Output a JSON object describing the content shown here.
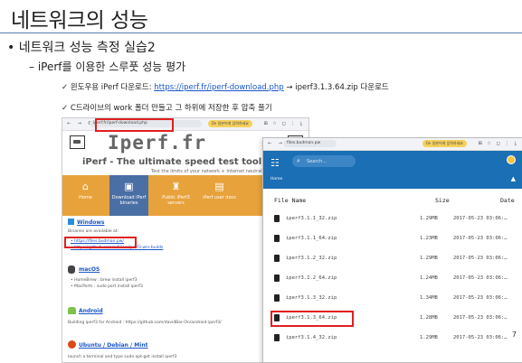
{
  "slide": {
    "title": "네트워크의 성능",
    "bullet1": "• 네트워크 성능 측정 실습2",
    "bullet2": "– iPerf를 이용한 스루풋 성능 평가",
    "line1_prefix": "✓ 윈도우용 iPerf 다운로드: ",
    "line1_link": "https://iperf.fr/iperf-download.php",
    "line1_suffix": " → iperf3.1.3.64.zip 다운로드",
    "line2": "✓ C드라이브의 work 폴더 만들고 그 하위에 저장한 후 압축 풀기",
    "page_number": "7"
  },
  "browser1": {
    "nav_glyphs": "← → C",
    "url": "iperf.fr/iperf-download.php",
    "tools": "⊞ ☆ ◻ ⋮ ⤓",
    "ext_label": "On 일본어게 입력하세요",
    "logo": "Iperf.fr",
    "tagline": "iPerf - The ultimate speed test tool for TCP",
    "subtagline": "Test the limits of your network + Internet neutrali",
    "nav_items": [
      {
        "icon": "home-icon",
        "glyph": "⌂",
        "label": "Home"
      },
      {
        "icon": "download-icon",
        "glyph": "▣",
        "label": "Download iPerf binaries"
      },
      {
        "icon": "servers-icon",
        "glyph": "♜",
        "label": "Public iPerf3 servers"
      },
      {
        "icon": "docs-icon",
        "glyph": "▤",
        "label": "iPerf user docs"
      }
    ],
    "windows_heading": "Windows",
    "windows_intro": "Binaries are available at:",
    "windows_link1": "• https://files.budman.pw/",
    "windows_link2": "• https://github.com/ar51an/iperf3-win-builds",
    "macos_heading": "macOS",
    "macos_line1": "• HomeBrew : brew install iperf3",
    "macos_line2": "• MacPorts : sudo port install iperf3",
    "android_heading": "Android",
    "android_line": "Building iperf3 for Android : https://github.com/davidBar-On/android-iperf3/",
    "ubuntu_heading": "Ubuntu / Debian / Mint",
    "ubuntu_line": "launch a terminal and type sudo apt-get install iperf3"
  },
  "browser2": {
    "url": "files.budman.pw",
    "tools": "⊞ ☆ ◻ ⋮ ⤓",
    "ext_label": "On 일본어게 입력하세요",
    "search_placeholder": "Search...",
    "home_label": "Home",
    "col_name": "File Name",
    "col_size": "Size",
    "col_date": "Date",
    "files": [
      {
        "name": "iperf3.1.1_32.zip",
        "size": "1.29MB",
        "date": "2017-05-23 03:06:…"
      },
      {
        "name": "iperf3.1.1_64.zip",
        "size": "1.23MB",
        "date": "2017-05-23 03:06:…"
      },
      {
        "name": "iperf3.1.2_32.zip",
        "size": "1.29MB",
        "date": "2017-05-23 03:06:…"
      },
      {
        "name": "iperf3.1.2_64.zip",
        "size": "1.24MB",
        "date": "2017-05-23 03:06:…"
      },
      {
        "name": "iperf3.1.3_32.zip",
        "size": "1.34MB",
        "date": "2017-05-23 03:06:…"
      },
      {
        "name": "iperf3.1.3_64.zip",
        "size": "1.28MB",
        "date": "2017-05-23 03:06:…"
      },
      {
        "name": "iperf3.1.4_32.zip",
        "size": "1.29MB",
        "date": "2017-05-23 03:06:…"
      }
    ]
  },
  "colors": {
    "accent_rule": "#5b7fb0",
    "highlight": "#e02020",
    "orange_nav": "#e8a23b",
    "appbar": "#1a6fb5"
  }
}
